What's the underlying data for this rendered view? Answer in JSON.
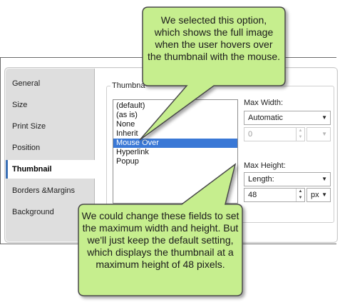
{
  "sidebar": {
    "items": [
      {
        "label": "General",
        "active": false
      },
      {
        "label": "Size",
        "active": false
      },
      {
        "label": "Print Size",
        "active": false
      },
      {
        "label": "Position",
        "active": false
      },
      {
        "label": "Thumbnail",
        "active": true
      },
      {
        "label": "Borders &Margins",
        "active": false
      },
      {
        "label": "Background",
        "active": false
      }
    ]
  },
  "thumbnail": {
    "group_label": "Thumbna",
    "options": [
      "(default)",
      "(as is)",
      "None",
      "Inherit",
      "Mouse Over",
      "Hyperlink",
      "Popup"
    ],
    "selected_option": "Mouse Over",
    "max_width": {
      "label": "Max Width:",
      "unit_value": "Automatic",
      "number_value": "0"
    },
    "max_height": {
      "label": "Max Height:",
      "unit_value": "Length:",
      "number_value": "48",
      "units": "px"
    }
  },
  "callouts": {
    "top": "We selected this option, which shows the full image when the user hovers over the thumbnail with the mouse.",
    "bottom": "We could change these fields to set the maximum width and height. But we'll just keep the default setting, which displays the thumbnail at a maximum height of 48 pixels."
  },
  "colors": {
    "callout_fill": "#c6ee8e",
    "callout_stroke": "#4a4a4a",
    "selection": "#3a78d6",
    "active_accent": "#3a6fb5"
  },
  "icons": {
    "dropdown": "chevron-down-icon",
    "spinner_up": "spin-up-icon",
    "spinner_down": "spin-down-icon"
  }
}
